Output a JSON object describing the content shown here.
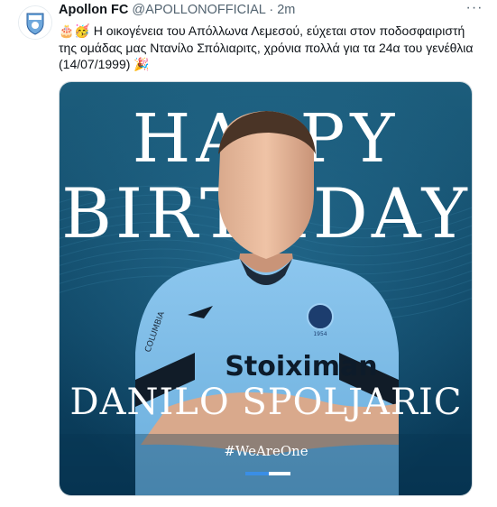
{
  "tweet": {
    "author_name": "Apollon FC",
    "handle": "@APOLLONOFFICIAL",
    "separator": "·",
    "time": "2m",
    "more_icon": "ellipsis-icon",
    "emoji_prefix": "🎂🥳",
    "text": "Η οικογένεια του Απόλλωνα Λεμεσού, εύχεται στον ποδοσφαιριστή της ομάδας μας Ντανίλο Σπόλιαριτς, χρόνια πολλά για τα 24α του γενέθλια (14/07/1999)",
    "emoji_suffix": "🎉"
  },
  "media": {
    "headline_line1": "HAPPY",
    "headline_line2": "BIRTHDAY",
    "player_name": "DANILO SPOLJARIC",
    "hashtag": "#WeAreOne",
    "shirt_sponsor": "Stoiximan",
    "sleeve_text": "COLUMBIA",
    "badge_year": "1954",
    "colors": {
      "background_top": "#1c5d7c",
      "background_bottom": "#073451",
      "shirt": "#7fbbe6",
      "accent_blue": "#3a8ee6",
      "text_white": "#ffffff"
    }
  }
}
